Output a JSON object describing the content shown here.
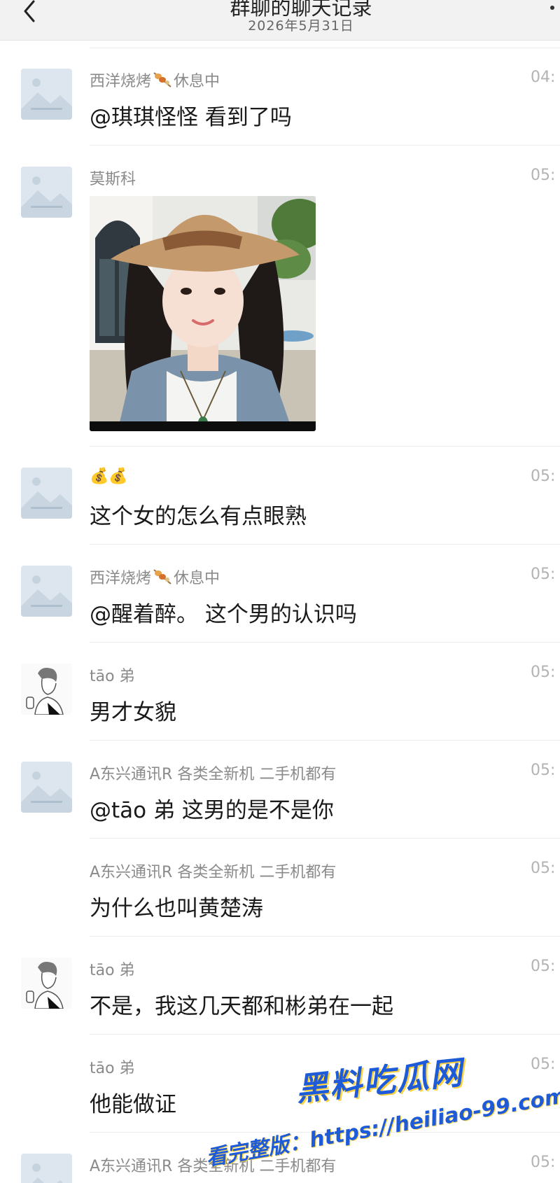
{
  "header": {
    "title": "群聊的聊天记录",
    "date": "2026年5月31日",
    "back_icon": "chevron-left-icon",
    "more_icon": "more-icon"
  },
  "messages": [
    {
      "avatar": "placeholder-image-icon",
      "sender": "西洋烧烤",
      "sender_emoji": "skewer-emoji",
      "status": "休息中",
      "time": "04:",
      "text": "@琪琪怪怪 看到了吗"
    },
    {
      "avatar": "placeholder-image-icon",
      "sender": "莫斯科",
      "time": "05:",
      "image": "photo-girl-in-straw-hat"
    },
    {
      "avatar": "placeholder-image-icon",
      "sender": "💰💰",
      "time": "05:",
      "text": "这个女的怎么有点眼熟"
    },
    {
      "avatar": "placeholder-image-icon",
      "sender": "西洋烧烤",
      "sender_emoji": "skewer-emoji",
      "status": "休息中",
      "time": "05:",
      "text": "@醒着醉。 这个男的认识吗"
    },
    {
      "avatar": "sketch-boy-avatar",
      "sender": "tāo 弟",
      "time": "05:",
      "text": "男才女貌"
    },
    {
      "avatar": "placeholder-image-icon",
      "sender": "A东兴通讯R 各类全新机 二手机都有",
      "time": "05:",
      "text": "@tāo 弟 这男的是不是你"
    },
    {
      "sender": "A东兴通讯R 各类全新机 二手机都有",
      "time": "05:",
      "text": "为什么也叫黄楚涛"
    },
    {
      "avatar": "sketch-boy-avatar",
      "sender": "tāo 弟",
      "time": "05:",
      "text": "不是，我这几天都和彬弟在一起"
    },
    {
      "sender": "tāo 弟",
      "time": "05:",
      "text": "他能做证"
    },
    {
      "avatar": "placeholder-image-icon",
      "sender": "A东兴通讯R 各类全新机 二手机都有",
      "time": "05:",
      "text": ""
    }
  ],
  "watermark": {
    "brand": "黑料吃瓜网",
    "url": "看完整版：https://heiliao-99.com"
  }
}
